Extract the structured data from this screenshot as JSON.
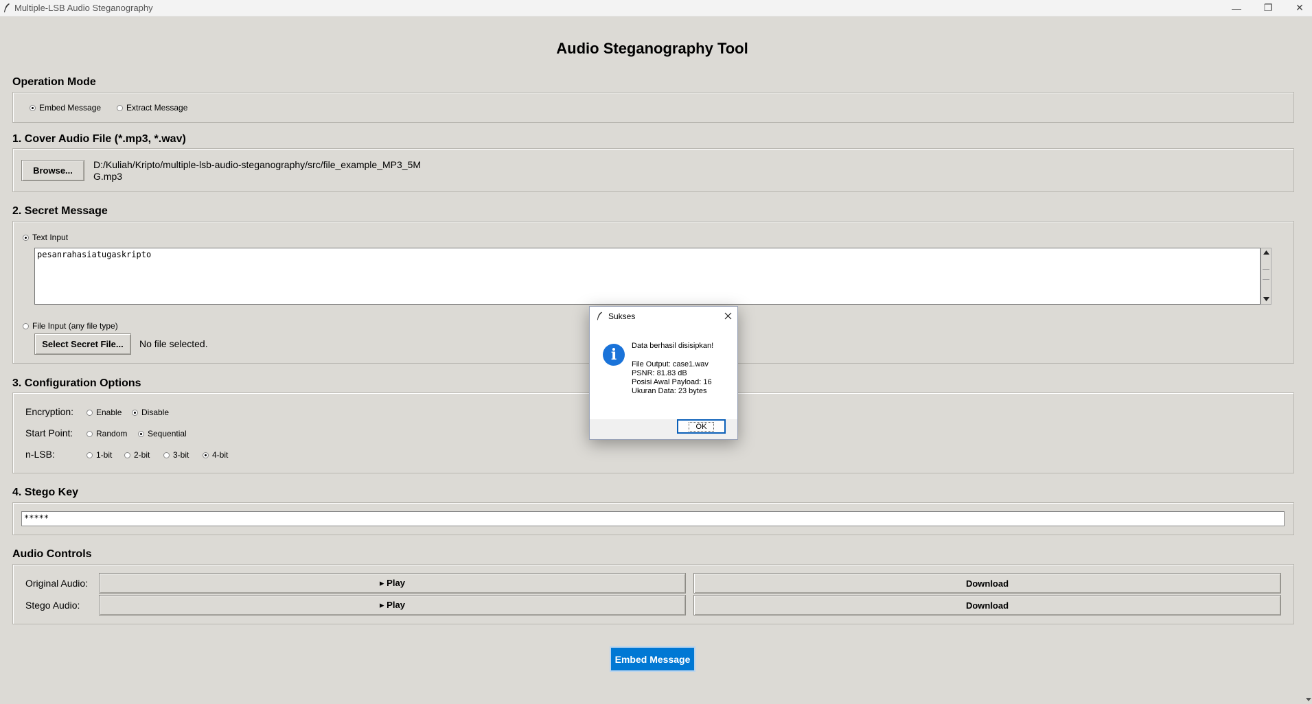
{
  "window": {
    "title": "Multiple-LSB Audio Steganography",
    "minimize": "—",
    "restore": "❐",
    "close": "✕"
  },
  "heading": "Audio Steganography Tool",
  "operation_mode": {
    "title": "Operation Mode",
    "options": [
      {
        "label": "Embed Message",
        "selected": true
      },
      {
        "label": "Extract Message",
        "selected": false
      }
    ]
  },
  "cover_audio": {
    "title": "1. Cover Audio File (*.mp3, *.wav)",
    "browse_label": "Browse...",
    "path_line1": "D:/Kuliah/Kripto/multiple-lsb-audio-steganography/src/file_example_MP3_5M",
    "path_line2": "G.mp3"
  },
  "secret_message": {
    "title": "2. Secret Message",
    "text_input_label": "Text Input",
    "text_value": "pesanrahasiatugaskripto",
    "file_input_label": "File Input (any file type)",
    "select_file_label": "Select Secret File...",
    "file_status": "No file selected."
  },
  "configuration": {
    "title": "3. Configuration Options",
    "encryption": {
      "label": "Encryption:",
      "options": [
        "Enable",
        "Disable"
      ],
      "selected": "Disable"
    },
    "start_point": {
      "label": "Start Point:",
      "options": [
        "Random",
        "Sequential"
      ],
      "selected": "Sequential"
    },
    "nlsb": {
      "label": "n-LSB:",
      "options": [
        "1-bit",
        "2-bit",
        "3-bit",
        "4-bit"
      ],
      "selected": "4-bit"
    }
  },
  "stego_key": {
    "title": "4. Stego Key",
    "value": "*****"
  },
  "audio_controls": {
    "title": "Audio Controls",
    "original_label": "Original Audio:",
    "stego_label": "Stego Audio:",
    "play_label": "▸ Play",
    "download_label": "Download"
  },
  "embed_button": "Embed Message",
  "dialog": {
    "title": "Sukses",
    "icon": "info-icon",
    "headline": "Data berhasil disisipkan!",
    "lines": [
      "File Output: case1.wav",
      "PSNR: 81.83 dB",
      "Posisi Awal Payload: 16",
      "Ukuran Data: 23 bytes"
    ],
    "ok_label": "OK"
  },
  "colors": {
    "background": "#dcdad5",
    "accent": "#0078d4",
    "info": "#1a73d9"
  }
}
